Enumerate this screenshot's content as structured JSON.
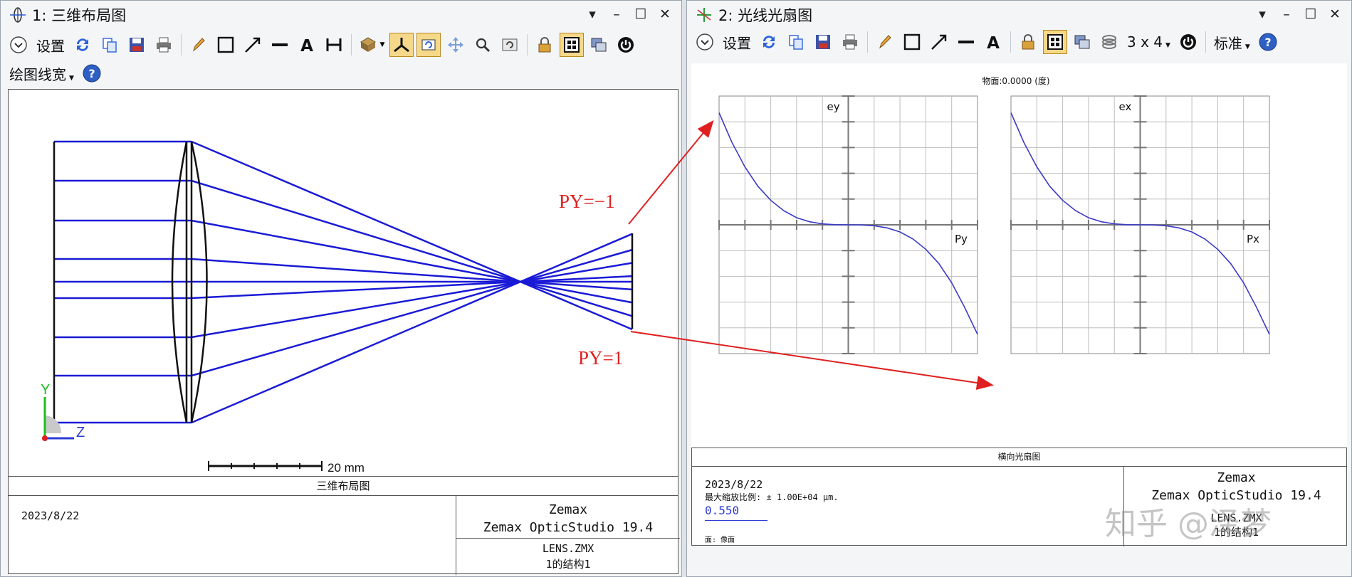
{
  "window1": {
    "title": "1: 三维布局图",
    "toolbar": {
      "settings_label": "设置",
      "line_width_label": "绘图线宽"
    },
    "scale_bar": "20 mm",
    "axes": {
      "y": "Y",
      "z": "Z"
    },
    "footer": {
      "caption": "三维布局图",
      "date": "2023/8/22",
      "company": "Zemax",
      "product": "Zemax OpticStudio 19.4",
      "file": "LENS.ZMX",
      "config": "1的结构1"
    }
  },
  "annotations": {
    "label_top": "PY=−1",
    "label_bottom": "PY=1",
    "arrow_color": "#e02020"
  },
  "window2": {
    "title": "2: 光线光扇图",
    "toolbar": {
      "settings_label": "设置",
      "layout_label": "3 x 4",
      "standard_label": "标准"
    },
    "plot_title": "物面:0.0000 (度)",
    "footer": {
      "caption": "横向光扇图",
      "date": "2023/8/22",
      "max_scale": "最大缩放比例: ± 1.00E+04 µm.",
      "wavelength": "0.550",
      "surface": "面: 像面",
      "company": "Zemax",
      "product": "Zemax OpticStudio 19.4",
      "file": "LENS.ZMX",
      "config": "1的结构1"
    },
    "watermark": "知乎 @泽梦"
  },
  "colors": {
    "ray": "#1a1ad6",
    "lens": "#111111",
    "fan_curve": "#3a3ac8",
    "grid": "#bdbdbd",
    "highlight": "#f5d889"
  },
  "chart_data": [
    {
      "type": "line",
      "title": "物面:0.0000 (度)",
      "xlabel": "Py",
      "ylabel": "ey",
      "xlim": [
        -1,
        1
      ],
      "ylim": [
        -1,
        1
      ],
      "grid": true,
      "series": [
        {
          "x": [
            -1.0,
            -0.9,
            -0.8,
            -0.7,
            -0.6,
            -0.5,
            -0.4,
            -0.3,
            -0.2,
            -0.1,
            0.0,
            0.1,
            0.2,
            0.3,
            0.4,
            0.5,
            0.6,
            0.7,
            0.8,
            0.9,
            1.0
          ],
          "values": [
            0.87,
            0.64,
            0.45,
            0.3,
            0.19,
            0.11,
            0.055,
            0.024,
            0.007,
            0.001,
            0.0,
            -0.001,
            -0.007,
            -0.024,
            -0.055,
            -0.11,
            -0.19,
            -0.3,
            -0.45,
            -0.64,
            -0.85
          ]
        }
      ]
    },
    {
      "type": "line",
      "title": "",
      "xlabel": "Px",
      "ylabel": "ex",
      "xlim": [
        -1,
        1
      ],
      "ylim": [
        -1,
        1
      ],
      "grid": true,
      "series": [
        {
          "x": [
            -1.0,
            -0.9,
            -0.8,
            -0.7,
            -0.6,
            -0.5,
            -0.4,
            -0.3,
            -0.2,
            -0.1,
            0.0,
            0.1,
            0.2,
            0.3,
            0.4,
            0.5,
            0.6,
            0.7,
            0.8,
            0.9,
            1.0
          ],
          "values": [
            0.87,
            0.64,
            0.45,
            0.3,
            0.19,
            0.11,
            0.055,
            0.024,
            0.007,
            0.001,
            0.0,
            -0.001,
            -0.007,
            -0.024,
            -0.055,
            -0.11,
            -0.19,
            -0.3,
            -0.45,
            -0.64,
            -0.85
          ]
        }
      ]
    }
  ]
}
